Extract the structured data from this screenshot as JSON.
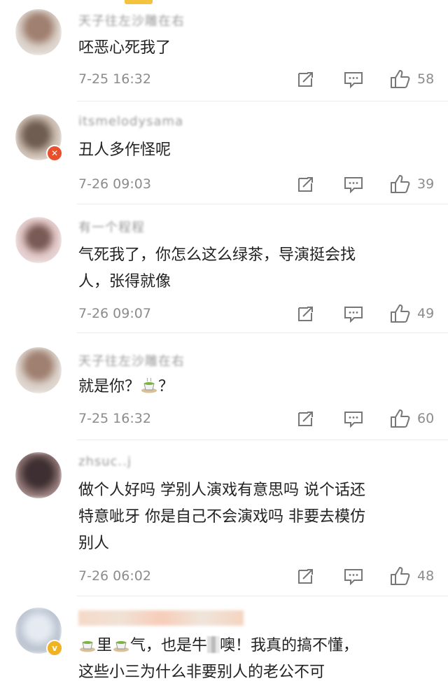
{
  "comments": [
    {
      "username": "天子往左沙雕在右",
      "lines": [
        "呸恶心死我了"
      ],
      "time": "7-25 16:32",
      "likes": "58",
      "avatar_color": "#c9b8ae"
    },
    {
      "username": "itsmelodysama",
      "lines": [
        "丑人多作怪呢"
      ],
      "time": "7-26 09:03",
      "likes": "39",
      "avatar_color": "#b7a699",
      "badge": "verified-red"
    },
    {
      "username": "有一个程程",
      "lines": [
        "气死我了，你怎么这么绿茶，导演挺会找",
        "人，张得就像"
      ],
      "time": "7-26 09:07",
      "likes": "49",
      "avatar_color": "#d8b7b8"
    },
    {
      "username": "天子往左沙雕在右",
      "line_prefix": "就是你？",
      "line_suffix": "？",
      "time": "7-25 16:32",
      "likes": "60",
      "avatar_color": "#c9b8ae"
    },
    {
      "username": "zhsuc..j",
      "lines": [
        "做个人好吗 学别人演戏有意思吗 说个话还",
        "特意呲牙 你是自己不会演戏吗 非要去模仿",
        "别人"
      ],
      "time": "7-26 06:02",
      "likes": "48",
      "avatar_color": "#5a4a48"
    },
    {
      "username": "",
      "line1_a": "里",
      "line1_b": "气，也是牛",
      "line1_c": "噢！我真的搞不懂，",
      "line2": "这些小三为什么非要别人的老公不可",
      "avatar_color": "#c7ccd6",
      "badge": "verified-gold"
    }
  ],
  "icons": {
    "repost": "repost-icon",
    "comment": "comment-icon",
    "like": "like-icon",
    "tea": "tea-cup-emoji"
  },
  "colors": {
    "text": "#222222",
    "meta": "#8c8c8c",
    "accent": "#f4c23c"
  }
}
